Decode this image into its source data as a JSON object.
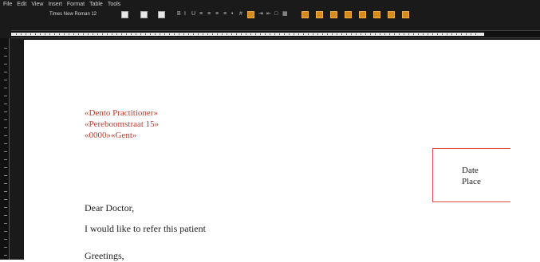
{
  "menu": [
    "File",
    "Edit",
    "View",
    "Insert",
    "Format",
    "Table",
    "Tools"
  ],
  "toolbar": {
    "font_name": "Times New Roman",
    "font_size": "12"
  },
  "document": {
    "field_name": "«Dento Practitioner»",
    "field_street": "«Pereboomstraat 15»",
    "field_city": "«0000»«Gent»",
    "date_label": "Date",
    "place_label": "Place",
    "salutation": "Dear Doctor,",
    "body_line": "I would like to refer this patient",
    "closing": "Greetings,"
  },
  "colors": {
    "field": "#c0392b",
    "box_border": "#e05050",
    "chrome": "#1a1a1a",
    "accent": "#d98a1c"
  }
}
